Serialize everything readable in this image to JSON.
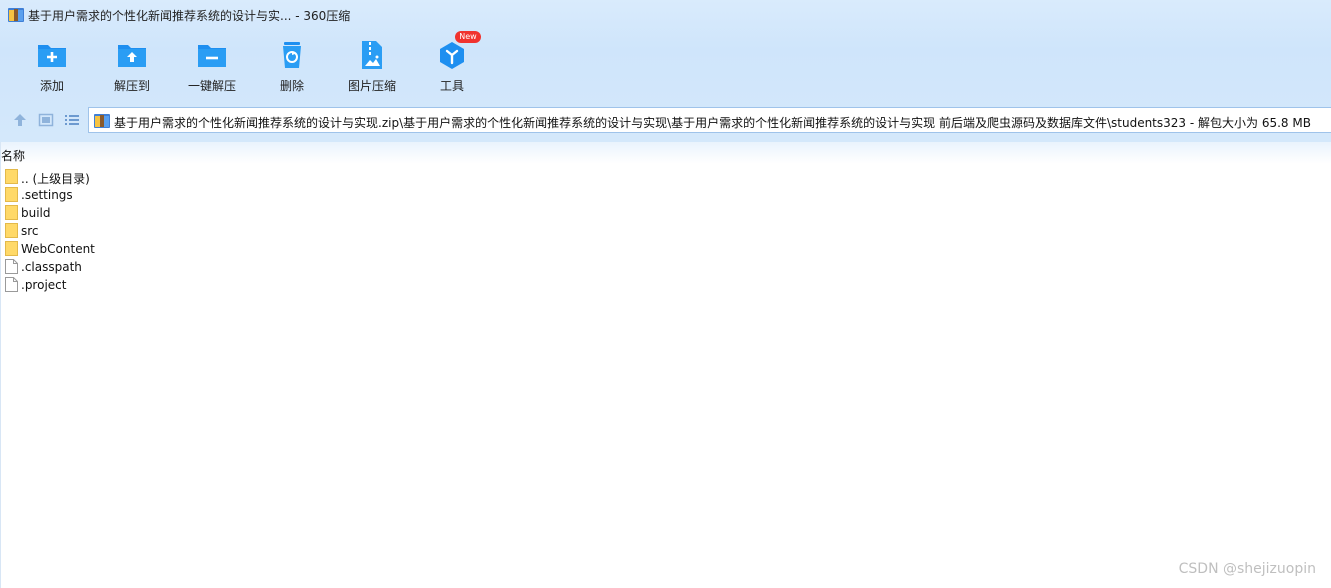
{
  "window": {
    "title": "基于用户需求的个性化新闻推荐系统的设计与实... - 360压缩"
  },
  "toolbar": {
    "items": [
      {
        "label": "添加",
        "icon": "add-folder-icon"
      },
      {
        "label": "解压到",
        "icon": "extract-to-icon"
      },
      {
        "label": "一键解压",
        "icon": "one-click-extract-icon"
      },
      {
        "label": "删除",
        "icon": "recycle-bin-icon"
      },
      {
        "label": "图片压缩",
        "icon": "image-compress-icon"
      },
      {
        "label": "工具",
        "icon": "tools-cube-icon"
      }
    ],
    "new_badge": "New"
  },
  "nav": {
    "path": "基于用户需求的个性化新闻推荐系统的设计与实现.zip\\基于用户需求的个性化新闻推荐系统的设计与实现\\基于用户需求的个性化新闻推荐系统的设计与实现 前后端及爬虫源码及数据库文件\\students323 - 解包大小为 65.8 MB"
  },
  "list": {
    "column_name": "名称",
    "items": [
      {
        "name": ".. (上级目录)",
        "type": "folder"
      },
      {
        "name": ".settings",
        "type": "folder"
      },
      {
        "name": "build",
        "type": "folder"
      },
      {
        "name": "src",
        "type": "folder"
      },
      {
        "name": "WebContent",
        "type": "folder"
      },
      {
        "name": ".classpath",
        "type": "file"
      },
      {
        "name": ".project",
        "type": "file"
      }
    ]
  },
  "watermark": "CSDN @shejizuopin",
  "colors": {
    "accent_blue": "#1e90ff",
    "chrome_bg": "#d4e8fb",
    "folder_yellow": "#ffd968",
    "badge_red": "#f0332f"
  }
}
